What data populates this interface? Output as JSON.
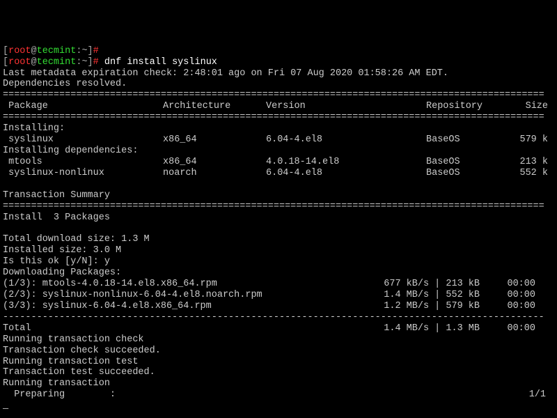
{
  "prompt": {
    "user": "root",
    "at": "@",
    "host": "tecmint",
    "cwd": ":~",
    "bracket_open": "[",
    "bracket_close": "]",
    "hash": "#"
  },
  "line_empty_cmd": " ",
  "cmd": " dnf install syslinux",
  "metadata": "Last metadata expiration check: 2:48:01 ago on Fri 07 Aug 2020 01:58:26 AM EDT.",
  "deps_resolved": "Dependencies resolved.",
  "double_rule": "================================================================================================",
  "header": {
    "package": " Package",
    "arch": "Architecture",
    "version": "Version",
    "repo": "Repository",
    "size": "Size"
  },
  "installing_label": "Installing:",
  "installing_deps_label": "Installing dependencies:",
  "pkg1": {
    "name": " syslinux",
    "arch": "x86_64",
    "version": "6.04-4.el8",
    "repo": "BaseOS",
    "size": "579 k"
  },
  "pkg2": {
    "name": " mtools",
    "arch": "x86_64",
    "version": "4.0.18-14.el8",
    "repo": "BaseOS",
    "size": "213 k"
  },
  "pkg3": {
    "name": " syslinux-nonlinux",
    "arch": "noarch",
    "version": "6.04-4.el8",
    "repo": "BaseOS",
    "size": "552 k"
  },
  "trans_summary": "Transaction Summary",
  "install_count": "Install  3 Packages",
  "dl_size": "Total download size: 1.3 M",
  "inst_size": "Installed size: 3.0 M",
  "confirm": "Is this ok [y/N]: y",
  "dl_label": "Downloading Packages:",
  "dl1": {
    "left": "(1/3): mtools-4.0.18-14.el8.x86_64.rpm",
    "rate": "677 kB/s | 213 kB",
    "time": "00:00"
  },
  "dl2": {
    "left": "(2/3): syslinux-nonlinux-6.04-4.el8.noarch.rpm",
    "rate": "1.4 MB/s | 552 kB",
    "time": "00:00"
  },
  "dl3": {
    "left": "(3/3): syslinux-6.04-4.el8.x86_64.rpm",
    "rate": "1.2 MB/s | 579 kB",
    "time": "00:00"
  },
  "dash_rule": "------------------------------------------------------------------------------------------------",
  "total": {
    "left": "Total",
    "rate": "1.4 MB/s | 1.3 MB",
    "time": "00:00"
  },
  "run_check": "Running transaction check",
  "check_ok": "Transaction check succeeded.",
  "run_test": "Running transaction test",
  "test_ok": "Transaction test succeeded.",
  "run_trans": "Running transaction",
  "preparing": "  Preparing        :",
  "prep_count": "1/1",
  "underscore": "_"
}
